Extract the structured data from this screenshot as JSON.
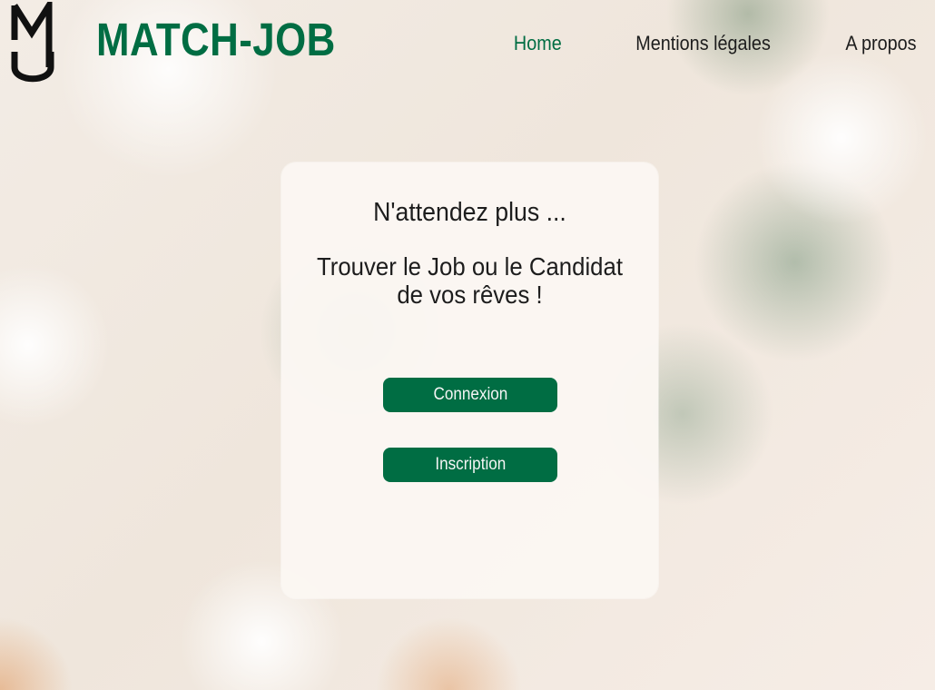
{
  "brand": {
    "name": "MATCH-JOB",
    "logo_text": "MJ"
  },
  "nav": {
    "items": [
      {
        "label": "Home",
        "active": true
      },
      {
        "label": "Mentions légales",
        "active": false
      },
      {
        "label": "A propos",
        "active": false
      }
    ]
  },
  "hero": {
    "headline": "N'attendez plus ...",
    "subline": "Trouver le Job ou le Candidat de vos rêves !"
  },
  "actions": {
    "login_label": "Connexion",
    "signup_label": "Inscription"
  },
  "colors": {
    "accent": "#006d43",
    "text": "#1d1d1d",
    "card": "#fbf7f3"
  }
}
